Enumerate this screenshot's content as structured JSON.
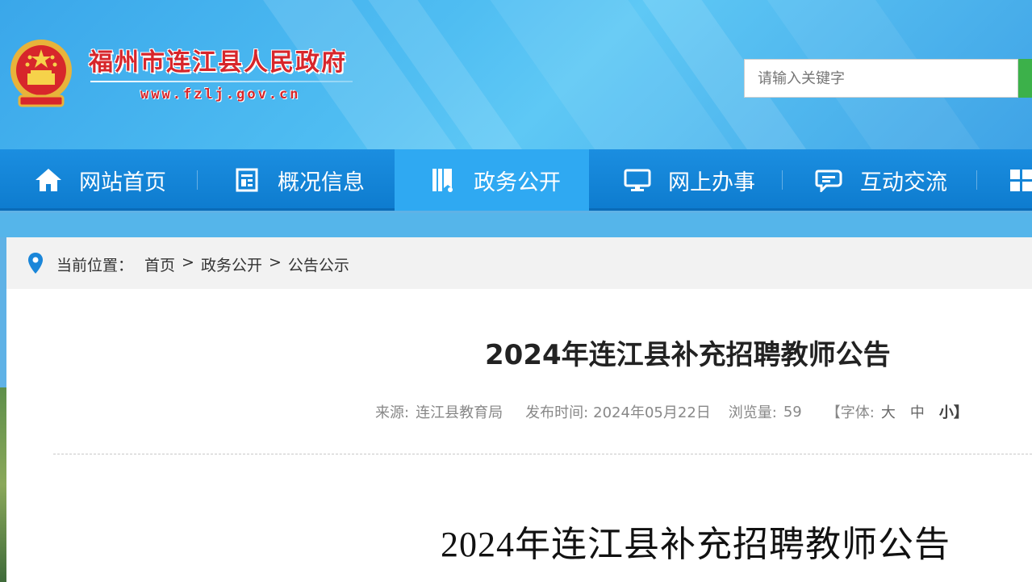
{
  "header": {
    "site_title": "福州市连江县人民政府",
    "site_url": "www.fzlj.gov.cn",
    "search_placeholder": "请输入关键字"
  },
  "nav": {
    "items": [
      {
        "label": "网站首页",
        "icon": "home-icon"
      },
      {
        "label": "概况信息",
        "icon": "document-icon"
      },
      {
        "label": "政务公开",
        "icon": "bookmark-icon"
      },
      {
        "label": "网上办事",
        "icon": "monitor-icon"
      },
      {
        "label": "互动交流",
        "icon": "chat-icon"
      },
      {
        "label": "",
        "icon": "grid-icon"
      }
    ],
    "active_index": 2
  },
  "breadcrumb": {
    "prefix": "当前位置：",
    "items": [
      "首页",
      "政务公开",
      "公告公示"
    ],
    "separator": ">"
  },
  "article": {
    "title": "2024年连江县补充招聘教师公告",
    "source_label": "来源:",
    "source": "连江县教育局",
    "date_label": "发布时间:",
    "date": "2024年05月22日",
    "views_label": "浏览量:",
    "views": "59",
    "font_label": "【字体:",
    "font_large": "大",
    "font_medium": "中",
    "font_small": "小】",
    "body_title": "2024年连江县补充招聘教师公告"
  },
  "colors": {
    "brand_red": "#d7262b",
    "nav_blue": "#0e7ccf",
    "nav_active": "#2fa9f2",
    "search_green": "#3cb14a"
  }
}
